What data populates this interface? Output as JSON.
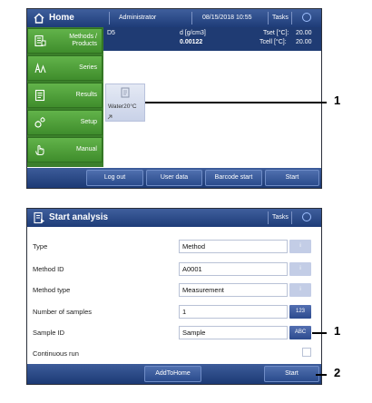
{
  "home": {
    "title": "Home",
    "user": "Administrator",
    "datetime": "08/15/2018  10:55",
    "tasks": "Tasks",
    "menu": [
      {
        "label": "Methods /\nProducts",
        "icon": "methods-icon"
      },
      {
        "label": "Series",
        "icon": "series-icon"
      },
      {
        "label": "Results",
        "icon": "results-icon"
      },
      {
        "label": "Setup",
        "icon": "setup-icon"
      },
      {
        "label": "Manual",
        "icon": "hand-icon"
      }
    ],
    "info": {
      "sample": "D5",
      "quantity_label": "d [g/cm3]",
      "quantity_value": "0.00122",
      "tset_label": "Tset [°C]:",
      "tset_value": "20.00",
      "tcell_label": "Tcell [°C]:",
      "tcell_value": "20.00"
    },
    "shortcut": {
      "label": "Water20°C"
    },
    "bottom": [
      "Log out",
      "User data",
      "Barcode start",
      "Start"
    ]
  },
  "start_analysis": {
    "title": "Start analysis",
    "tasks": "Tasks",
    "rows": [
      {
        "label": "Type",
        "value": "Method",
        "button": "i"
      },
      {
        "label": "Method ID",
        "value": "A0001",
        "button": "i"
      },
      {
        "label": "Method type",
        "value": "Measurement",
        "button": "i"
      },
      {
        "label": "Number of samples",
        "value": "1",
        "button": "123"
      },
      {
        "label": "Sample ID",
        "value": "Sample",
        "button": "ABC"
      },
      {
        "label": "Continuous run",
        "value": "",
        "button": ""
      }
    ],
    "bottom": [
      "AddToHome",
      "Start"
    ]
  },
  "callouts": [
    "1",
    "1",
    "2"
  ],
  "colors": {
    "titlebar": "#2a4a88",
    "menu_green": "#4fa03a",
    "info_panel": "#1f3b73",
    "button_blue": "#3a5a9c"
  }
}
